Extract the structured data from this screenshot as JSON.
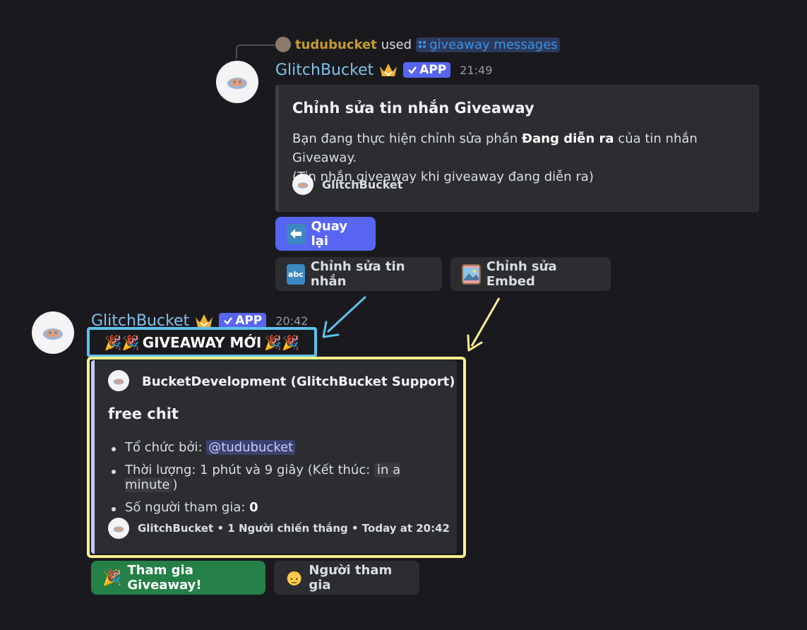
{
  "reply": {
    "user": "tudubucket",
    "used": "used",
    "command": "giveaway messages",
    "user_color": "#c59c2c",
    "command_color": "#3b91e5"
  },
  "msg1": {
    "author": "GlitchBucket",
    "badge": "APP",
    "time": "21:49",
    "embed": {
      "title": "Chỉnh sửa tin nhắn Giveaway",
      "desc_before": "Bạn đang thực hiện chỉnh sửa phần ",
      "desc_bold": "Đang diễn ra",
      "desc_after": " của tin nhắn Giveaway.",
      "desc_line2": "(Tin nhắn giveaway khi giveaway đang diễn ra)",
      "footer": "GlitchBucket"
    },
    "buttons": {
      "back": "Quay lại",
      "edit_message": "Chỉnh sửa tin nhắn",
      "edit_message_icon_text": "abc",
      "edit_embed": "Chỉnh sửa Embed"
    }
  },
  "msg2": {
    "author": "GlitchBucket",
    "badge": "APP",
    "time": "20:42",
    "content": "GIVEAWAY MỚI",
    "embed": {
      "author": "BucketDevelopment (GlitchBucket Support)",
      "title": "free chit",
      "host_label": "Tổ chức bởi: ",
      "host_mention": "@tudubucket",
      "duration_label": "Thời lượng: 1 phút và 9 giây (Kết thúc: ",
      "duration_code": "in a minute",
      "duration_close": ")",
      "participants_label": "Số người tham gia: ",
      "participants_count": "0",
      "footer": "GlitchBucket • 1 Người chiến thắng • Today at 20:42"
    },
    "buttons": {
      "join": "Tham gia Giveaway!",
      "participants": "Người tham gia"
    }
  },
  "colors": {
    "highlight_blue": "#5ec1ea",
    "highlight_yellow": "#fbf08f",
    "accent": "#5865f2",
    "success": "#248046",
    "bot_name": "#7fc1e8"
  },
  "icons": [
    "party-popper-icon",
    "crown-icon",
    "check-icon",
    "back-arrow-icon",
    "picture-icon",
    "person-icon"
  ]
}
